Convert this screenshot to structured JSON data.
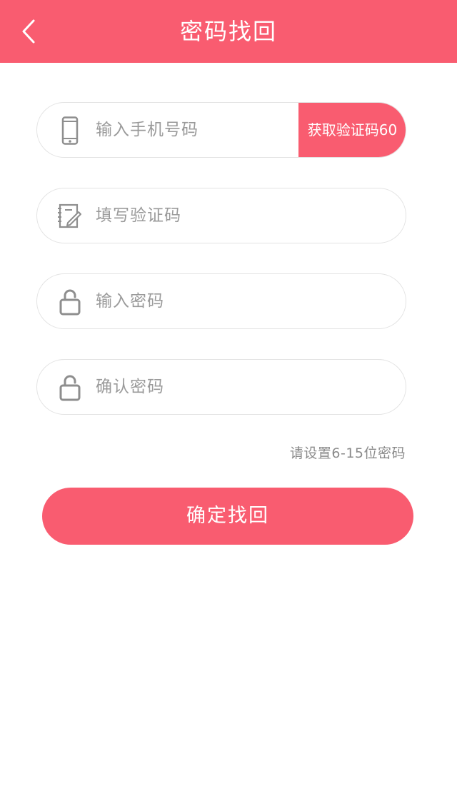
{
  "header": {
    "title": "密码找回",
    "back_icon": "chevron-left-icon"
  },
  "form": {
    "phone": {
      "placeholder": "输入手机号码",
      "icon": "phone-icon",
      "code_button_label": "获取验证码60"
    },
    "code": {
      "placeholder": "填写验证码",
      "icon": "edit-note-icon"
    },
    "password": {
      "placeholder": "输入密码",
      "icon": "unlock-icon"
    },
    "confirm_password": {
      "placeholder": "确认密码",
      "icon": "unlock-icon"
    },
    "hint": "请设置6-15位密码",
    "submit_label": "确定找回"
  },
  "colors": {
    "accent": "#f95c70",
    "icon_gray": "#8e8e8e",
    "border": "#e3e3e3"
  }
}
